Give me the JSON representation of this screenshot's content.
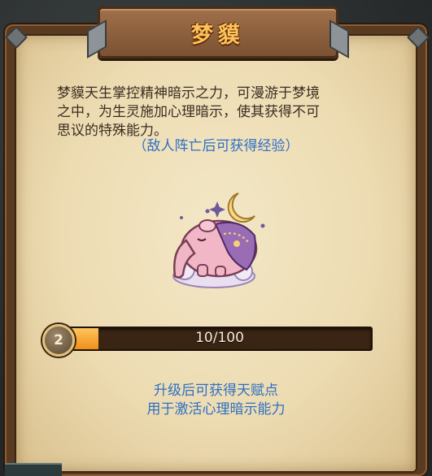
{
  "title": "梦貘",
  "description": [
    "梦貘天生掌控精神暗示之力，可漫游于梦境",
    "之中，为生灵施加心理暗示，使其获得不可",
    "思议的特殊能力。"
  ],
  "hint": "（敌人阵亡后可获得经验）",
  "level": {
    "value": "2",
    "progress_text": "10/100",
    "current": 10,
    "max": 100
  },
  "talent_lines": [
    "升级后可获得天赋点",
    "用于激活心理暗示能力"
  ],
  "icons": {
    "creature": "dream-tapir-creature-icon"
  },
  "colors": {
    "title": "#ffc25a",
    "hint": "#2f6fc4",
    "bar_fill": "#f08f1c"
  }
}
